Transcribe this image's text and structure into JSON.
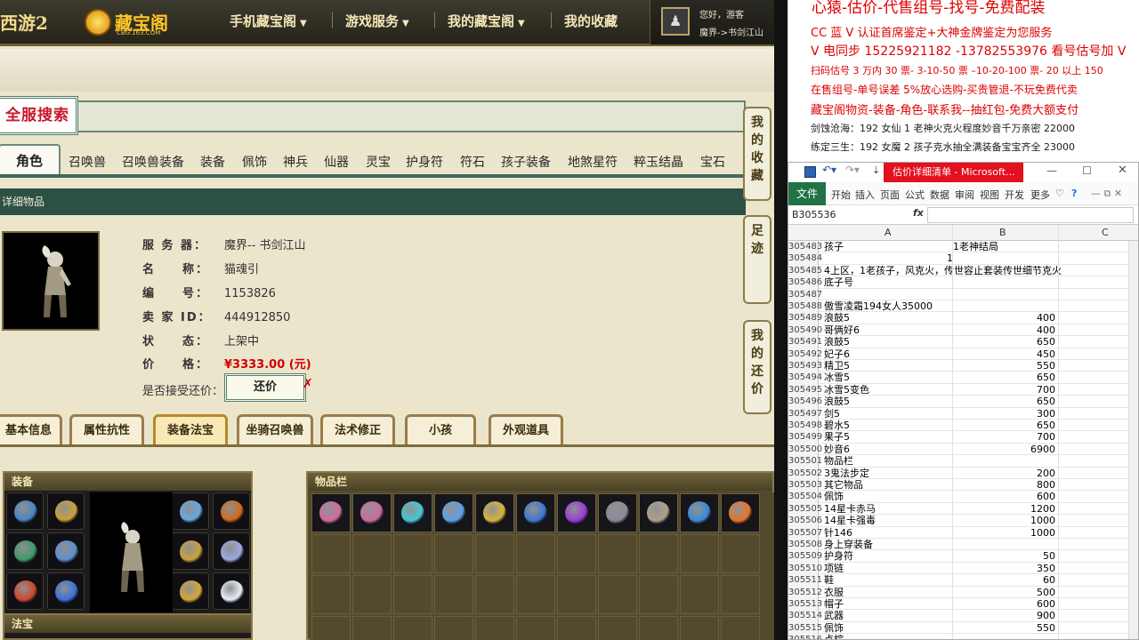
{
  "site": {
    "logo_game": "西游2",
    "logo_name": "藏宝阁",
    "logo_sub": "CBG.163.COM",
    "nav": [
      {
        "label": "手机藏宝阁",
        "has_caret": true
      },
      {
        "label": "游戏服务",
        "has_caret": true
      },
      {
        "label": "我的藏宝阁",
        "has_caret": true
      },
      {
        "label": "我的收藏",
        "has_caret": false
      }
    ],
    "nav_caret": "▼",
    "user": {
      "greeting": "您好，游客",
      "server": "魔界->书剑江山"
    },
    "search_title": "全服搜索",
    "category_tabs": [
      "角色",
      "召唤兽",
      "召唤兽装备",
      "装备",
      "佩饰",
      "神兵",
      "仙器",
      "灵宝",
      "护身符",
      "符石",
      "孩子装备",
      "地煞星符",
      "粹玉结晶",
      "宝石"
    ],
    "side_buttons": [
      "我的收藏",
      "足迹",
      "我的还价"
    ],
    "detail_header": "详细物品",
    "item": {
      "server_label": "服 务 器：",
      "server": "魔界-- 书剑江山",
      "name_label": "名　　称：",
      "name": "猫魂引",
      "id_label": "编　　号：",
      "id": "1153826",
      "seller_label": "卖 家 ID：",
      "seller": "444912850",
      "status_label": "状　　态：",
      "status": "上架中",
      "price_label": "价　　格：",
      "price": "¥3333.00 (元)",
      "counter_label": "是否接受还价：",
      "counter_btn": "还价",
      "counter_mark": "✗"
    },
    "detail_tabs": [
      "基本信息",
      "属性抗性",
      "装备法宝",
      "坐骑召唤兽",
      "法术修正",
      "小孩",
      "外观道具"
    ],
    "active_detail_tab": "装备法宝",
    "panels": {
      "equip": "装备",
      "items": "物品栏",
      "fabao": "法宝"
    }
  },
  "ad": {
    "lines": [
      "心猿-估价-代售组号-找号-免费配装",
      "CC 蓝 V 认证首席鉴定+大神金牌鉴定为您服务",
      "V 电同步 15225921182 -13782553976 看号估号加 V",
      "扫码估号 3 万内 30 票- 3-10-50 票 –10-20-100 票- 20 以上 150",
      "在售组号-单号误差 5%放心选购-买贵管退-不玩免费代卖",
      "藏宝阁物资-装备-角色-联系我--抽红包-免费大额支付",
      "剑蚀沧海：192 女仙 1 老神火克火程度妙音千万亲密 22000",
      "练定三生：192 女魔 2 孩子克水抽全满装备宝宝齐全 23000"
    ]
  },
  "excel": {
    "title": "估价详细清单 - Microsoft...",
    "ribbon_tabs": [
      "文件",
      "开始",
      "插入",
      "页面",
      "公式",
      "数据",
      "审阅",
      "视图",
      "开发",
      "更多"
    ],
    "name_box": "B305536",
    "fx": "fx",
    "columns": [
      "A",
      "B",
      "C"
    ],
    "rows": [
      {
        "n": "305483",
        "a": "孩子",
        "b": "1老神结局",
        "b_num": false
      },
      {
        "n": "305484",
        "a": "",
        "b": "1",
        "b_num": true,
        "b_left": true
      },
      {
        "n": "305485",
        "a": "4上区，1老孩子，风克火，传世容止套装传世细节克火",
        "b": "",
        "b_num": false
      },
      {
        "n": "305486",
        "a": "底子号",
        "b": "",
        "b_num": false
      },
      {
        "n": "305487",
        "a": "",
        "b": "",
        "b_num": false
      },
      {
        "n": "305488",
        "a": "傲雪凌霜194女人35000",
        "b": "",
        "b_num": false
      },
      {
        "n": "305489",
        "a": "浪鼓5",
        "b": "400",
        "b_num": true
      },
      {
        "n": "305490",
        "a": "哥俩好6",
        "b": "400",
        "b_num": true
      },
      {
        "n": "305491",
        "a": "浪鼓5",
        "b": "650",
        "b_num": true
      },
      {
        "n": "305492",
        "a": "妃子6",
        "b": "450",
        "b_num": true
      },
      {
        "n": "305493",
        "a": "精卫5",
        "b": "550",
        "b_num": true
      },
      {
        "n": "305494",
        "a": "冰雪5",
        "b": "650",
        "b_num": true
      },
      {
        "n": "305495",
        "a": "冰雪5变色",
        "b": "700",
        "b_num": true
      },
      {
        "n": "305496",
        "a": "浪鼓5",
        "b": "650",
        "b_num": true
      },
      {
        "n": "305497",
        "a": "剑5",
        "b": "300",
        "b_num": true
      },
      {
        "n": "305498",
        "a": "碧水5",
        "b": "650",
        "b_num": true
      },
      {
        "n": "305499",
        "a": "果子5",
        "b": "700",
        "b_num": true
      },
      {
        "n": "305500",
        "a": "妙音6",
        "b": "6900",
        "b_num": true
      },
      {
        "n": "305501",
        "a": "物品栏",
        "b": "",
        "b_num": false
      },
      {
        "n": "305502",
        "a": "3鬼法步定",
        "b": "200",
        "b_num": true
      },
      {
        "n": "305503",
        "a": "其它物品",
        "b": "800",
        "b_num": true
      },
      {
        "n": "305504",
        "a": "佩饰",
        "b": "600",
        "b_num": true
      },
      {
        "n": "305505",
        "a": "14星卡赤马",
        "b": "1200",
        "b_num": true
      },
      {
        "n": "305506",
        "a": "14星卡强毒",
        "b": "1000",
        "b_num": true
      },
      {
        "n": "305507",
        "a": "针146",
        "b": "1000",
        "b_num": true
      },
      {
        "n": "305508",
        "a": "身上穿装备",
        "b": "",
        "b_num": false
      },
      {
        "n": "305509",
        "a": "护身符",
        "b": "50",
        "b_num": true
      },
      {
        "n": "305510",
        "a": "项链",
        "b": "350",
        "b_num": true
      },
      {
        "n": "305511",
        "a": "鞋",
        "b": "60",
        "b_num": true
      },
      {
        "n": "305512",
        "a": "衣服",
        "b": "500",
        "b_num": true
      },
      {
        "n": "305513",
        "a": "帽子",
        "b": "600",
        "b_num": true
      },
      {
        "n": "305514",
        "a": "武器",
        "b": "900",
        "b_num": true
      },
      {
        "n": "305515",
        "a": "佩饰",
        "b": "550",
        "b_num": true
      },
      {
        "n": "305516",
        "a": "点棕",
        "b": "",
        "b_num": false
      }
    ]
  },
  "colors": {
    "price": "#d20000",
    "excel_green": "#217346",
    "excel_titlebar_red": "#e3101d",
    "ad_red": "#e00000",
    "detail_bar": "#2c5045"
  },
  "icons": {
    "equip": [
      "blue-helmet-icon",
      "gold-trinket-icon",
      "green-sword-icon",
      "blue-armor-icon",
      "red-fan-icon",
      "blue-scroll-icon",
      "blue-crown-icon",
      "fire-ring-icon",
      "gold-necklace-icon",
      "silver-ring-icon",
      "gold-belt-icon",
      "white-orb-icon"
    ],
    "items": [
      "pink-bell-icon",
      "pink-bell-icon",
      "cyan-bead-icon",
      "blue-bracelet-icon",
      "gold-lamp-icon",
      "blue-feather-icon",
      "purple-ring-icon",
      "grey-beast-icon",
      "figure-icon",
      "blue-wand-icon",
      "fire-orb-icon"
    ]
  }
}
